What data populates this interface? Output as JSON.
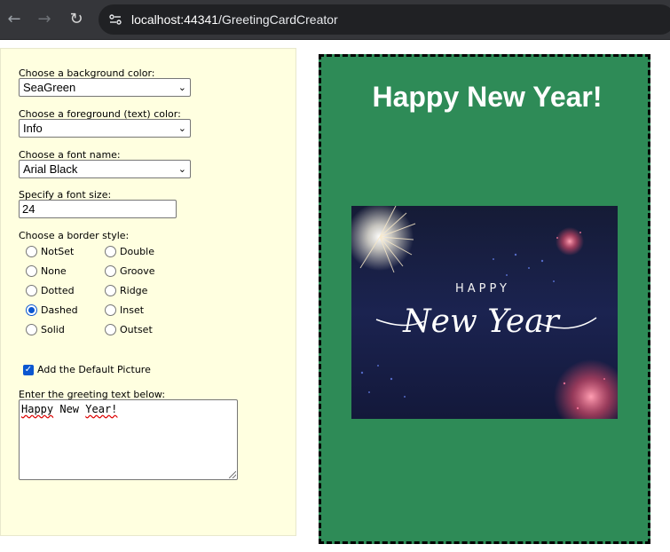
{
  "browser": {
    "url_host": "localhost:44341",
    "url_path": "/GreetingCardCreator"
  },
  "form": {
    "bg_label": "Choose a background color:",
    "bg_value": "SeaGreen",
    "fg_label": "Choose a foreground (text) color:",
    "fg_value": "Info",
    "font_label": "Choose a font name:",
    "font_value": "Arial Black",
    "size_label": "Specify a font size:",
    "size_value": "24",
    "border_label": "Choose a border style:",
    "border_options": [
      "NotSet",
      "None",
      "Dotted",
      "Dashed",
      "Solid",
      "Double",
      "Groove",
      "Ridge",
      "Inset",
      "Outset"
    ],
    "border_selected": "Dashed",
    "picture_label": "Add the Default Picture",
    "picture_checked": true,
    "greeting_label": "Enter the greeting text below:",
    "greeting_words": [
      "Happy",
      "New",
      "Year!"
    ]
  },
  "card": {
    "greeting": "Happy New Year!",
    "background": "#2e8b57",
    "border_style": "dashed",
    "image_text_top": "HAPPY",
    "image_text_main": "New Year"
  }
}
